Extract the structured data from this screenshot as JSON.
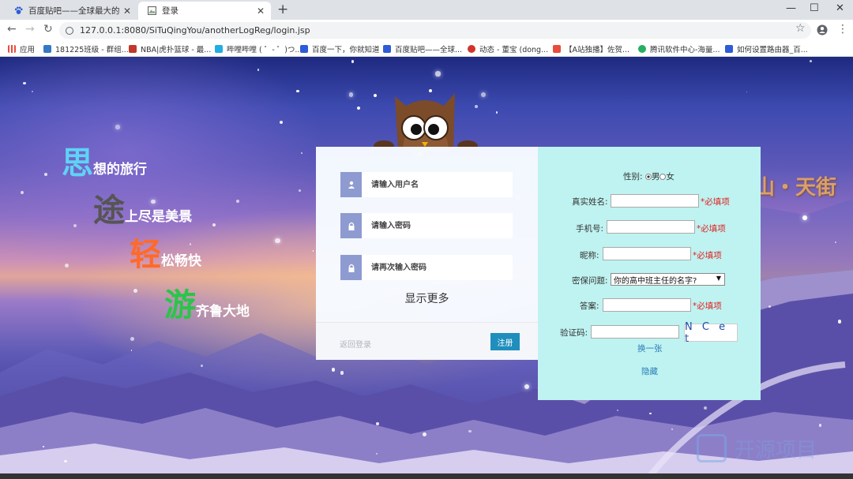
{
  "browser": {
    "tabs": [
      {
        "title": "百度贴吧——全球最大的中文社",
        "close": "✕"
      },
      {
        "title": "登录",
        "close": "✕"
      }
    ],
    "new_tab": "+",
    "window": {
      "minimize": "—",
      "maximize": "☐",
      "close": "✕"
    },
    "nav": {
      "back": "←",
      "forward": "→",
      "reload": "↻"
    },
    "url": "127.0.0.1:8080/SiTuQingYou/anotherLogReg/login.jsp",
    "star": "☆",
    "menu": "⋮",
    "bookmarks": [
      {
        "label": "应用",
        "color": "#e74c3c"
      },
      {
        "label": "181225班级 - 群组...",
        "color": "#3478c6"
      },
      {
        "label": "NBA|虎扑篮球 - 最...",
        "color": "#c0392b"
      },
      {
        "label": "哔哩哔哩 ( ゜- ゜)つ...",
        "color": "#23ade5"
      },
      {
        "label": "百度一下，你就知道",
        "color": "#2e5cd6"
      },
      {
        "label": "百度贴吧——全球...",
        "color": "#2e5cd6"
      },
      {
        "label": "动态 - 董宝 (dong...",
        "color": "#d0342c"
      },
      {
        "label": "【A站独播】佐贺...",
        "color": "#e74c3c"
      },
      {
        "label": "腾讯软件中心-海量...",
        "color": "#27ae60"
      },
      {
        "label": "如何设置路由器_百...",
        "color": "#2e5cd6"
      }
    ]
  },
  "slogans": [
    {
      "big": "思",
      "rest": "想的旅行",
      "color": "#5fd3f5"
    },
    {
      "big": "途",
      "rest": "上尽是美景",
      "color": "#555555"
    },
    {
      "big": "轻",
      "rest": "松畅快",
      "color": "#ff6a2a"
    },
    {
      "big": "游",
      "rest": "齐鲁大地",
      "color": "#2cc44a"
    }
  ],
  "banner_right": "山・天街",
  "login": {
    "username_placeholder": "请输入用户名",
    "password_placeholder": "请输入密码",
    "confirm_placeholder": "请再次输入密码",
    "show_more": "显示更多",
    "back_to_login": "返回登录",
    "register": "注册"
  },
  "register_panel": {
    "gender_label": "性别:",
    "male": "男",
    "female": "女",
    "realname_label": "真实姓名:",
    "phone_label": "手机号:",
    "nickname_label": "昵称:",
    "question_label": "密保问题:",
    "question_selected": "你的高中班主任的名字?",
    "answer_label": "答案:",
    "captcha_label": "验证码:",
    "required": "*必填项",
    "captcha_text": "N C e t",
    "change_captcha": "换一张",
    "hide": "隐藏"
  },
  "watermark": "开源项目",
  "colors": {
    "accent": "#1f8ebd",
    "panel": "#bff3f1",
    "required": "#e02020",
    "icon_box": "#8e9bd1"
  }
}
